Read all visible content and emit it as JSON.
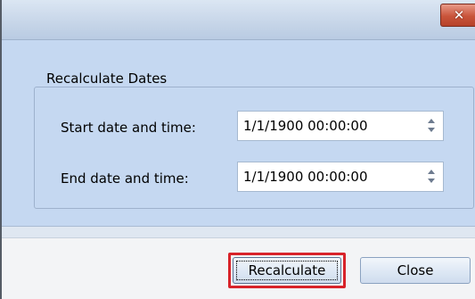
{
  "titlebar": {
    "close_glyph": "✕"
  },
  "group": {
    "title": "Recalculate Dates"
  },
  "fields": {
    "start": {
      "label": "Start date and time:",
      "value": "1/1/1900 00:00:00"
    },
    "end": {
      "label": "End date and time:",
      "value": "1/1/1900 00:00:00"
    }
  },
  "buttons": {
    "recalculate": "Recalculate",
    "close": "Close"
  },
  "colors": {
    "client_background": "#c5d8f1",
    "footer_background": "#f3f4f6",
    "highlight": "#d8232a",
    "close_button": "#c9543a"
  },
  "icons": {
    "spin_up": "chevron-up-icon",
    "spin_down": "chevron-down-icon"
  }
}
